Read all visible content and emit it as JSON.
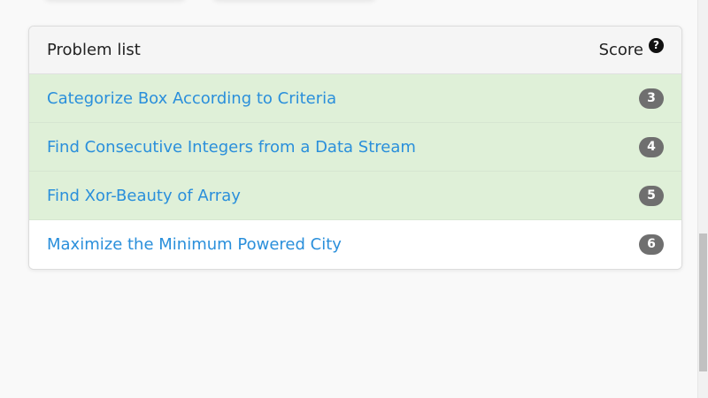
{
  "panel": {
    "title": "Problem list",
    "score_label": "Score",
    "help_glyph": "?"
  },
  "problems": [
    {
      "title": "Categorize Box According to Criteria",
      "score": "3",
      "solved": true
    },
    {
      "title": "Find Consecutive Integers from a Data Stream",
      "score": "4",
      "solved": true
    },
    {
      "title": "Find Xor-Beauty of Array",
      "score": "5",
      "solved": true
    },
    {
      "title": "Maximize the Minimum Powered City",
      "score": "6",
      "solved": false
    }
  ],
  "colors": {
    "solved_row": "#dff0d8",
    "link": "#2a8fdb",
    "badge": "#6f6f6f"
  },
  "icons": {
    "help": "question-circle-icon"
  }
}
